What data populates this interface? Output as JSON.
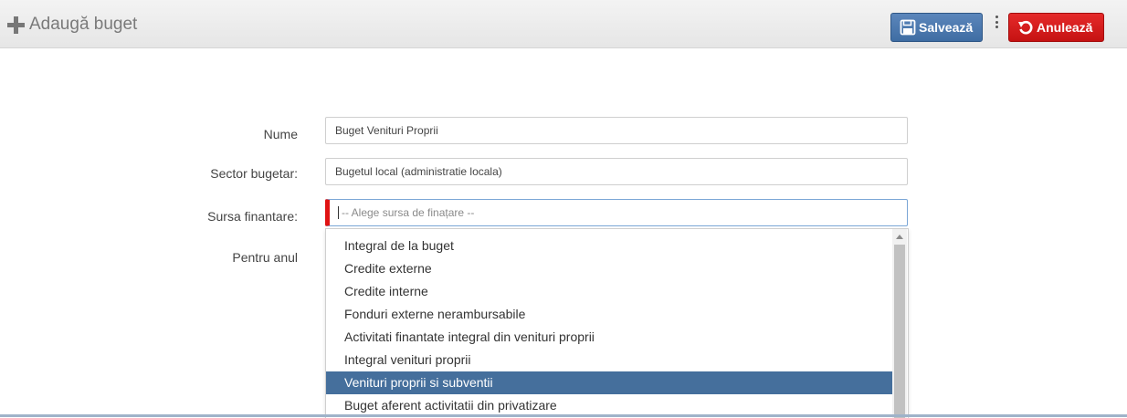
{
  "header": {
    "title": "Adaugă buget",
    "title_icon": "plus-icon",
    "save_label": "Salvează",
    "save_icon": "floppy-disk-icon",
    "cancel_label": "Anulează",
    "cancel_icon": "undo-icon",
    "colors": {
      "save": "#4a77ad",
      "cancel": "#d61a1a",
      "bar": "#ececec"
    }
  },
  "form": {
    "name": {
      "label": "Nume",
      "value": "Buget Venituri Proprii"
    },
    "sector": {
      "label": "Sector bugetar:",
      "value": "Bugetul local (administratie locala)"
    },
    "source": {
      "label": "Sursa finantare:",
      "placeholder": "-- Alege sursa de finațare --"
    },
    "year": {
      "label": "Pentru anul"
    }
  },
  "dropdown": {
    "options": [
      "Integral de la buget",
      "Credite externe",
      "Credite interne",
      "Fonduri externe nerambursabile",
      "Activitati finantate integral din venituri proprii",
      "Integral venituri proprii",
      "Venituri proprii si subventii",
      "Buget aferent activitatii din privatizare"
    ],
    "selected": "Venituri proprii si subventii",
    "selected_color": "#456f9c"
  }
}
